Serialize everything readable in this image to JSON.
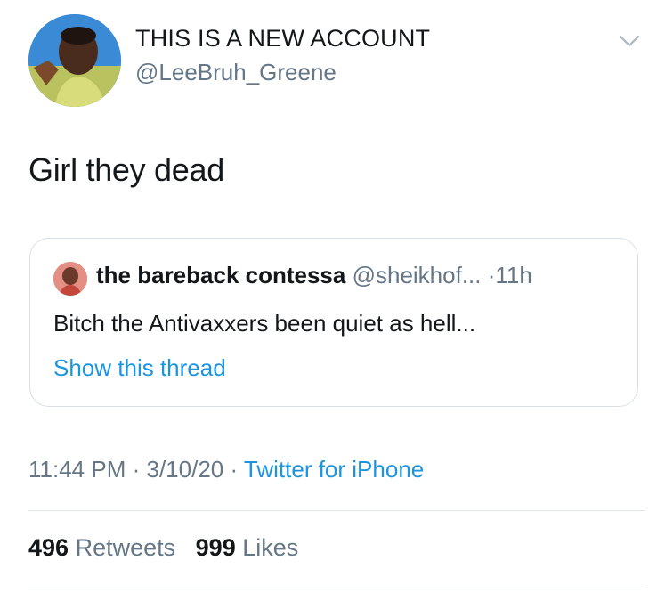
{
  "author": {
    "display_name": "THIS IS A NEW ACCOUNT",
    "handle": "@LeeBruh_Greene"
  },
  "tweet": {
    "text": "Girl they dead"
  },
  "quoted_tweet": {
    "name": "the bareback contessa",
    "handle": "@sheikhof...",
    "separator": "·",
    "time": "11h",
    "text": "Bitch the Antivaxxers been quiet as hell...",
    "thread_link": "Show this thread"
  },
  "meta": {
    "time": "11:44 PM",
    "sep1": "·",
    "date": "3/10/20",
    "sep2": "·",
    "source": "Twitter for iPhone"
  },
  "stats": {
    "retweets_count": "496",
    "retweets_label": "Retweets",
    "likes_count": "999",
    "likes_label": "Likes"
  },
  "icons": {
    "menu": "chevron-down-icon"
  },
  "colors": {
    "link": "#1b95e0",
    "secondary_text": "#657786",
    "primary_text": "#14171a",
    "border": "#d9dfe4"
  }
}
